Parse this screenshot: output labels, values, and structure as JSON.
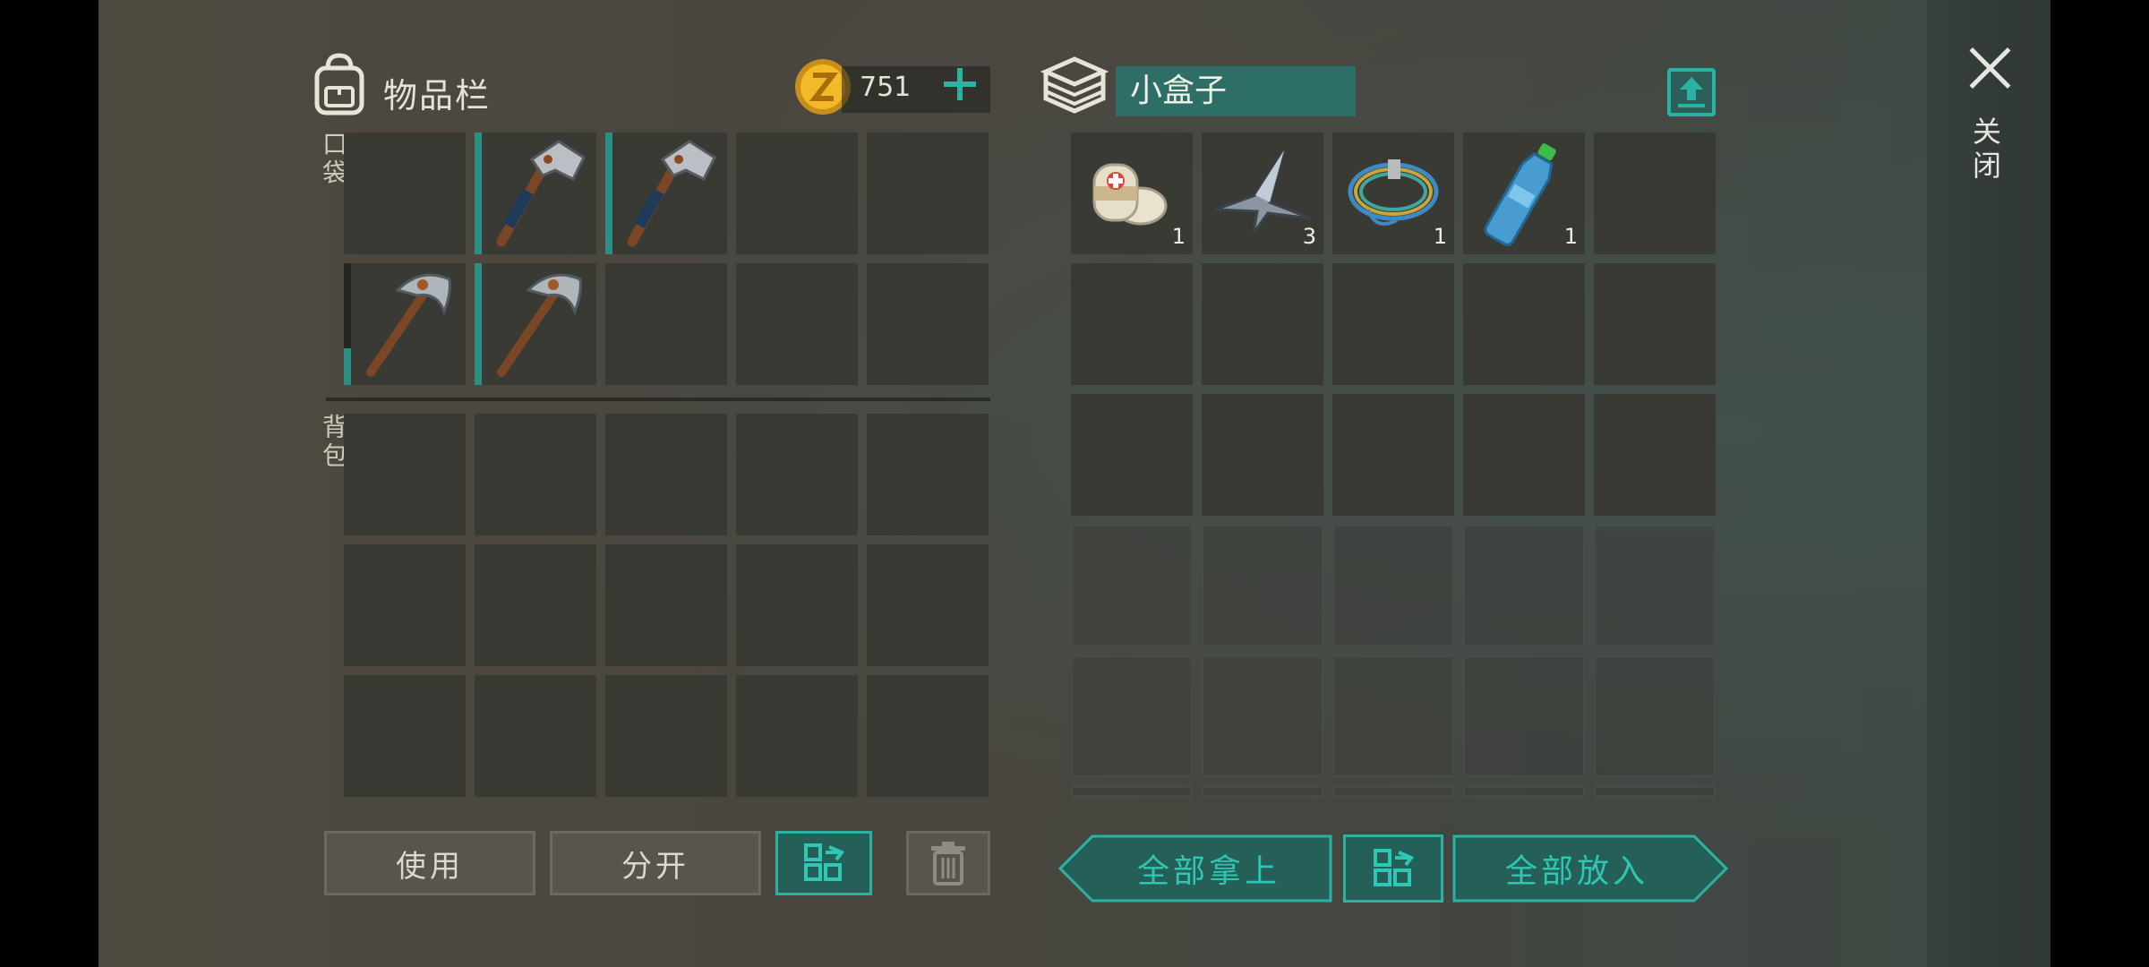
{
  "inventory": {
    "title": "物品栏",
    "coins": "751",
    "pocket_label": "口袋",
    "backpack_label": "背包",
    "pocket_slots": [
      {
        "item": "",
        "count": ""
      },
      {
        "item": "hatchet-icon",
        "count": "",
        "durability": 1.0
      },
      {
        "item": "hatchet-icon",
        "count": "",
        "durability": 1.0
      },
      {
        "item": "",
        "count": ""
      },
      {
        "item": "",
        "count": ""
      },
      {
        "item": "pickaxe-icon",
        "count": "",
        "durability": 0.3
      },
      {
        "item": "pickaxe-icon",
        "count": "",
        "durability": 1.0
      },
      {
        "item": "",
        "count": ""
      },
      {
        "item": "",
        "count": ""
      },
      {
        "item": "",
        "count": ""
      }
    ],
    "buttons": {
      "use": "使用",
      "split": "分开"
    }
  },
  "container": {
    "name": "小盒子",
    "slots": [
      {
        "item": "bandage-icon",
        "count": "1"
      },
      {
        "item": "scrap-metal-icon",
        "count": "3"
      },
      {
        "item": "rope-icon",
        "count": "1"
      },
      {
        "item": "water-bottle-icon",
        "count": "1"
      }
    ],
    "buttons": {
      "take_all": "全部拿上",
      "put_all": "全部放入"
    }
  },
  "close_label": "关闭",
  "colors": {
    "accent": "#2ab3a2",
    "slot": "#3a3a34"
  }
}
